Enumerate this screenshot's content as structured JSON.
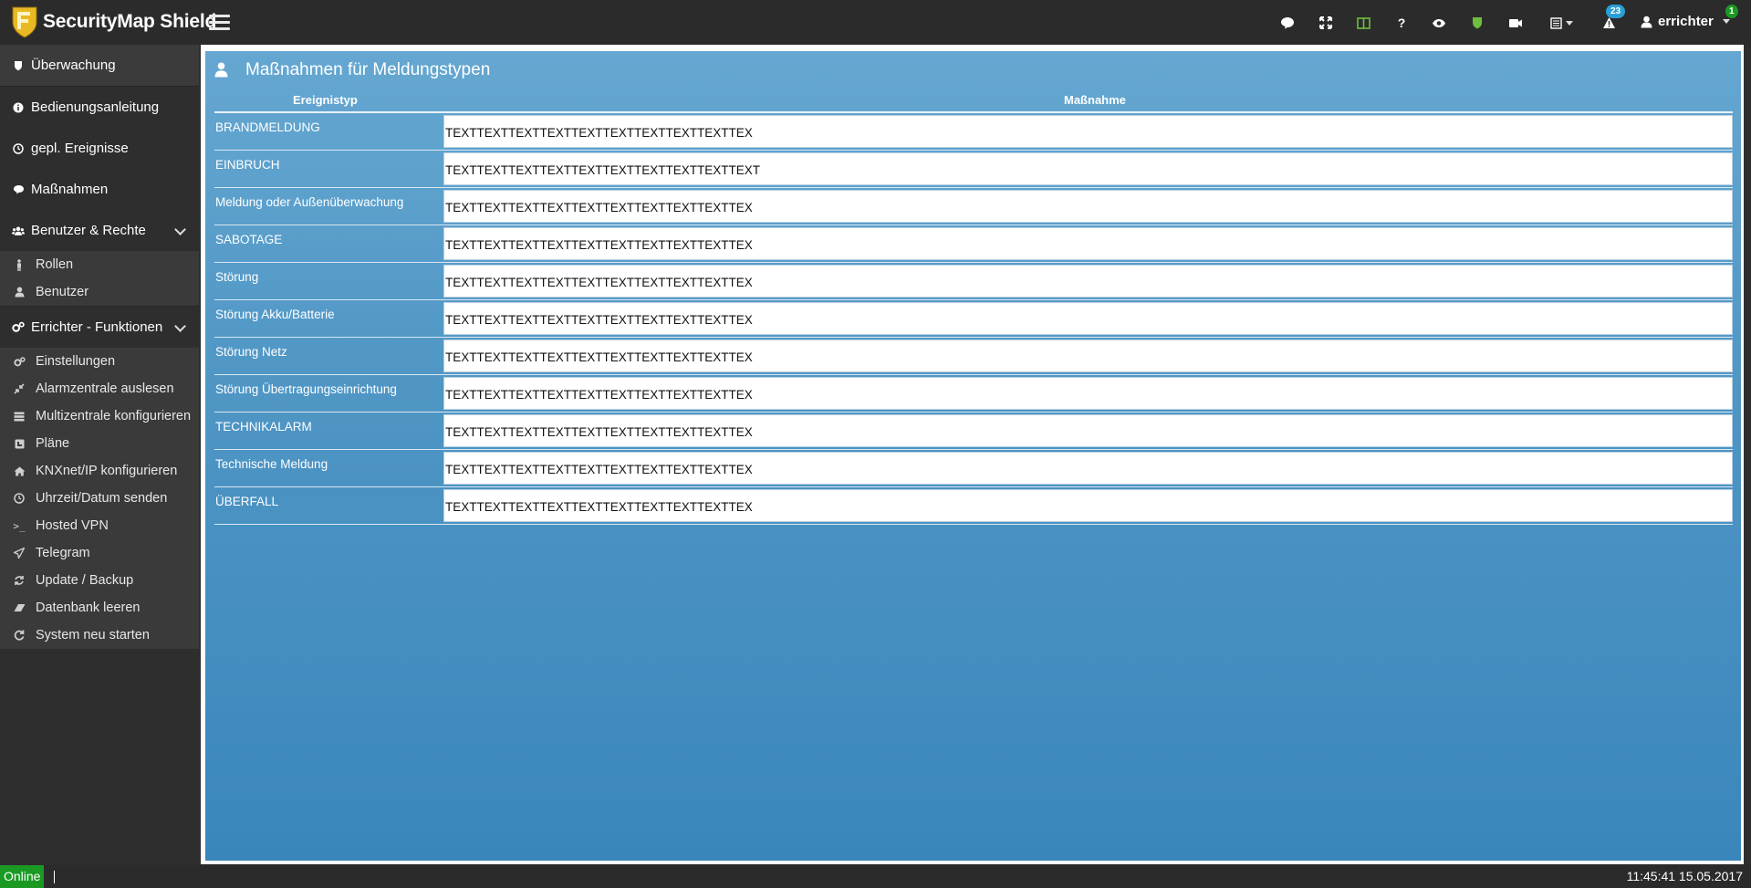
{
  "app": {
    "brand": "SecurityMap Shield"
  },
  "topbar": {
    "icons": [
      "chat-icon",
      "fullscreen-icon",
      "columns-icon",
      "help-icon",
      "eye-icon",
      "shield-icon",
      "camera-icon",
      "list-dropdown-icon",
      "alerts-icon"
    ],
    "alerts_badge": "23",
    "user_badge": "1",
    "user": "errichter",
    "colors": {
      "accent_green": "#6fbf3f",
      "badge_blue": "#2a9fd6",
      "badge_green": "#1a9a22"
    }
  },
  "sidebar": {
    "items": [
      {
        "label": "Überwachung",
        "icon": "shield-icon"
      },
      {
        "label": "Bedienungsanleitung",
        "icon": "info-icon"
      },
      {
        "label": "gepl. Ereignisse",
        "icon": "clock-icon"
      },
      {
        "label": "Maßnahmen",
        "icon": "chat-icon"
      },
      {
        "label": "Benutzer & Rechte",
        "icon": "users-icon"
      }
    ],
    "users_sub": [
      {
        "label": "Rollen",
        "icon": "person-icon"
      },
      {
        "label": "Benutzer",
        "icon": "user-icon"
      }
    ],
    "errichter": {
      "label": "Errichter - Funktionen",
      "icon": "cogs-icon"
    },
    "errichter_sub": [
      {
        "label": "Einstellungen",
        "icon": "cogs-icon"
      },
      {
        "label": "Alarmzentrale auslesen",
        "icon": "compress-icon"
      },
      {
        "label": "Multizentrale konfigurieren",
        "icon": "server-icon"
      },
      {
        "label": "Pläne",
        "icon": "floorplan-icon"
      },
      {
        "label": "KNXnet/IP konfigurieren",
        "icon": "home-icon"
      },
      {
        "label": "Uhrzeit/Datum senden",
        "icon": "clock-icon"
      },
      {
        "label": "Hosted VPN",
        "icon": "terminal-icon"
      },
      {
        "label": "Telegram",
        "icon": "send-icon"
      },
      {
        "label": "Update / Backup",
        "icon": "refresh-icon"
      },
      {
        "label": "Datenbank leeren",
        "icon": "eraser-icon"
      },
      {
        "label": "System neu starten",
        "icon": "restart-icon"
      }
    ]
  },
  "main": {
    "title": "Maßnahmen für Meldungstypen",
    "col_event": "Ereignistyp",
    "col_action": "Maßnahme",
    "rows": [
      {
        "event": "BRANDMELDUNG",
        "action": "TEXTTEXTTEXTTEXTTEXTTEXTTEXTTEXTTEXTTEX"
      },
      {
        "event": "EINBRUCH",
        "action": "TEXTTEXTTEXTTEXTTEXTTEXTTEXTTEXTTEXTTEXT"
      },
      {
        "event": "Meldung oder Außenüberwachung",
        "action": "TEXTTEXTTEXTTEXTTEXTTEXTTEXTTEXTTEXTTEX"
      },
      {
        "event": "SABOTAGE",
        "action": "TEXTTEXTTEXTTEXTTEXTTEXTTEXTTEXTTEXTTEX"
      },
      {
        "event": "Störung",
        "action": "TEXTTEXTTEXTTEXTTEXTTEXTTEXTTEXTTEXTTEX"
      },
      {
        "event": "Störung Akku/Batterie",
        "action": "TEXTTEXTTEXTTEXTTEXTTEXTTEXTTEXTTEXTTEX"
      },
      {
        "event": "Störung Netz",
        "action": "TEXTTEXTTEXTTEXTTEXTTEXTTEXTTEXTTEXTTEX"
      },
      {
        "event": "Störung Übertragungseinrichtung",
        "action": "TEXTTEXTTEXTTEXTTEXTTEXTTEXTTEXTTEXTTEX"
      },
      {
        "event": "TECHNIKALARM",
        "action": "TEXTTEXTTEXTTEXTTEXTTEXTTEXTTEXTTEXTTEX"
      },
      {
        "event": "Technische Meldung",
        "action": "TEXTTEXTTEXTTEXTTEXTTEXTTEXTTEXTTEXTTEX"
      },
      {
        "event": "ÜBERFALL",
        "action": "TEXTTEXTTEXTTEXTTEXTTEXTTEXTTEXTTEXTTEX"
      }
    ]
  },
  "statusbar": {
    "status": "Online",
    "datetime": "11:45:41 15.05.2017"
  }
}
